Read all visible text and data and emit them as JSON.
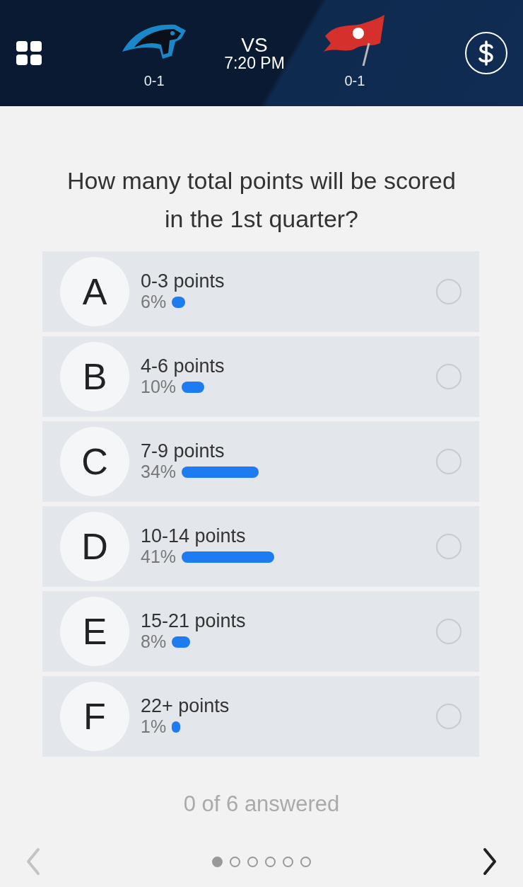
{
  "header": {
    "away_team": {
      "record": "0-1"
    },
    "home_team": {
      "record": "0-1"
    },
    "vs": "VS",
    "time": "7:20 PM"
  },
  "question": "How many total points will be scored in the 1st quarter?",
  "options": [
    {
      "letter": "A",
      "label": "0-3 points",
      "percent": "6%",
      "selected": false
    },
    {
      "letter": "B",
      "label": "4-6 points",
      "percent": "10%",
      "selected": false
    },
    {
      "letter": "C",
      "label": "7-9 points",
      "percent": "34%",
      "selected": false
    },
    {
      "letter": "D",
      "label": "10-14 points",
      "percent": "41%",
      "selected": false
    },
    {
      "letter": "E",
      "label": "15-21 points",
      "percent": "8%",
      "selected": false
    },
    {
      "letter": "F",
      "label": "22+ points",
      "percent": "1%",
      "selected": false
    }
  ],
  "progress": "0 of 6 answered",
  "pager": {
    "prev_disabled": true,
    "next_disabled": false,
    "pages": [
      {
        "selected": true
      },
      {
        "selected": false
      },
      {
        "selected": false
      },
      {
        "selected": false
      },
      {
        "selected": false
      },
      {
        "selected": false
      }
    ]
  }
}
